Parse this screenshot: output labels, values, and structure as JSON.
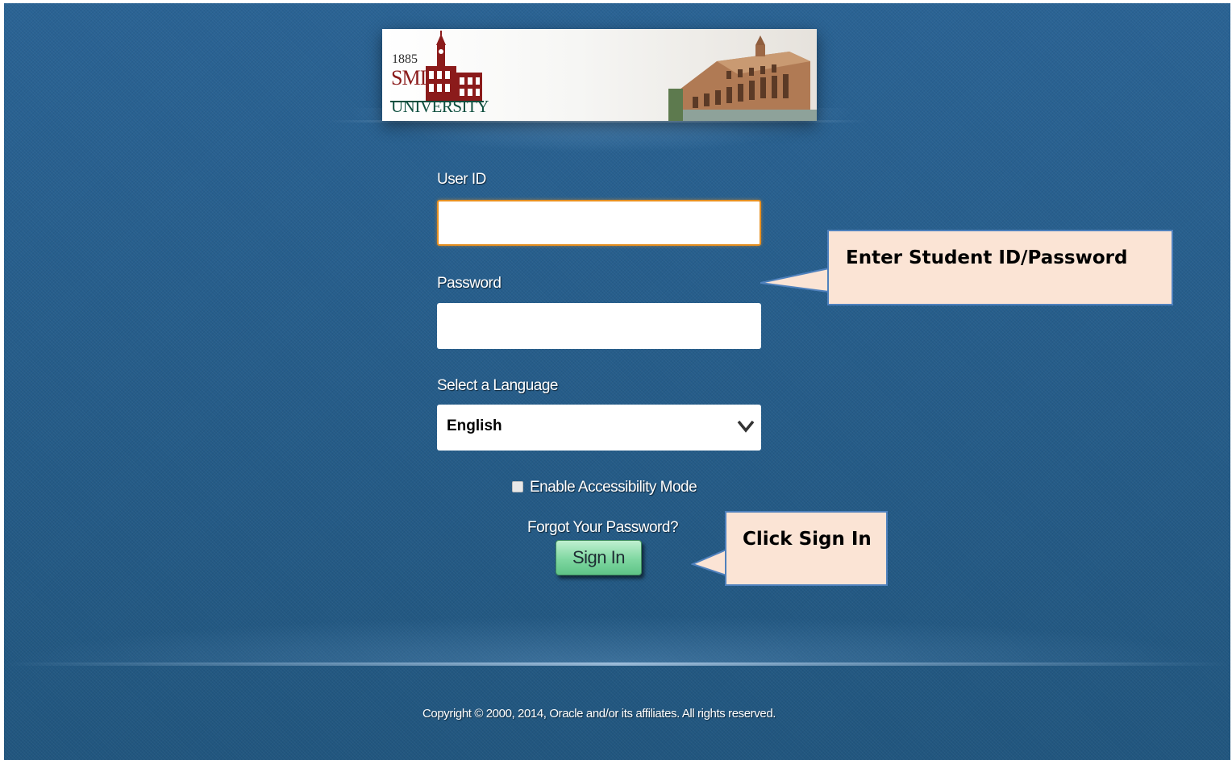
{
  "branding": {
    "year": "1885",
    "name": "SMI",
    "subtitle": "UNIVERSITY"
  },
  "form": {
    "userid_label": "User ID",
    "userid_value": "",
    "password_label": "Password",
    "password_value": "",
    "language_label": "Select a Language",
    "language_selected": "English",
    "accessibility_label": "Enable Accessibility Mode",
    "accessibility_checked": false,
    "forgot_password": "Forgot Your Password?",
    "signin_label": "Sign In"
  },
  "footer": {
    "copyright": "Copyright © 2000, 2014, Oracle and/or its affiliates. All rights reserved."
  },
  "annotations": {
    "credentials_note": "Enter Student ID/Password",
    "signin_note": "Click Sign In"
  },
  "icons": {
    "logo": "university-clocktower-icon",
    "campus": "campus-building-photo",
    "dropdown": "chevron-down-icon"
  },
  "colors": {
    "background": "#245b8a",
    "focus_border": "#e69022",
    "signin_button": "#7fd7a1",
    "callout_fill": "#fbe4d5",
    "callout_border": "#4f81bd"
  }
}
